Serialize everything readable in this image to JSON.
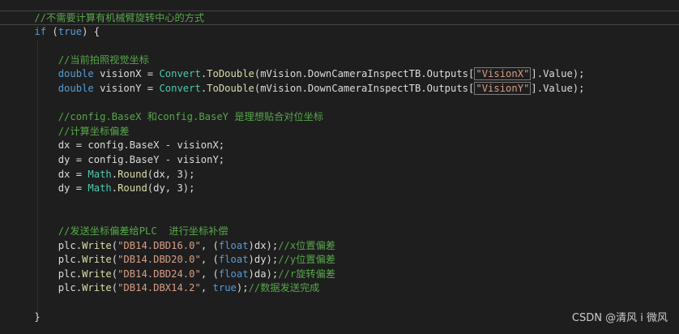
{
  "editor": {
    "theme_colors": {
      "background": "#1e1e1e",
      "comment": "#57a64a",
      "keyword": "#569cd6",
      "type": "#4ec9b0",
      "method": "#dcdcaa",
      "string": "#d69d85",
      "identifier": "#dcdcdc"
    },
    "lines": [
      {
        "tokens": [
          {
            "t": "    ",
            "c": "ident"
          },
          {
            "t": "//不需要计算有机械臂旋转中心的方式",
            "c": "comment"
          }
        ]
      },
      {
        "tokens": [
          {
            "t": "    ",
            "c": "ident"
          },
          {
            "t": "if",
            "c": "keyword"
          },
          {
            "t": " (",
            "c": "ident"
          },
          {
            "t": "true",
            "c": "keyword"
          },
          {
            "t": ") {",
            "c": "ident"
          }
        ]
      },
      {
        "tokens": []
      },
      {
        "tokens": [
          {
            "t": "        ",
            "c": "ident"
          },
          {
            "t": "//当前拍照视觉坐标",
            "c": "comment"
          }
        ]
      },
      {
        "tokens": [
          {
            "t": "        ",
            "c": "ident"
          },
          {
            "t": "double",
            "c": "keyword"
          },
          {
            "t": " visionX = ",
            "c": "ident"
          },
          {
            "t": "Convert",
            "c": "type"
          },
          {
            "t": ".",
            "c": "ident"
          },
          {
            "t": "ToDouble",
            "c": "method"
          },
          {
            "t": "(mVision.DownCameraInspectTB.Outputs[",
            "c": "ident"
          },
          {
            "t": "\"VisionX\"",
            "c": "string",
            "boxed": true
          },
          {
            "t": "].Value);",
            "c": "ident"
          }
        ]
      },
      {
        "tokens": [
          {
            "t": "        ",
            "c": "ident"
          },
          {
            "t": "double",
            "c": "keyword"
          },
          {
            "t": " visionY = ",
            "c": "ident"
          },
          {
            "t": "Convert",
            "c": "type"
          },
          {
            "t": ".",
            "c": "ident"
          },
          {
            "t": "ToDouble",
            "c": "method"
          },
          {
            "t": "(mVision.DownCameraInspectTB.Outputs[",
            "c": "ident"
          },
          {
            "t": "\"VisionY\"",
            "c": "string",
            "boxed": true
          },
          {
            "t": "].Value);",
            "c": "ident"
          }
        ]
      },
      {
        "tokens": []
      },
      {
        "tokens": [
          {
            "t": "        ",
            "c": "ident"
          },
          {
            "t": "//config.BaseX 和config.BaseY 是理想贴合对位坐标",
            "c": "comment"
          }
        ]
      },
      {
        "tokens": [
          {
            "t": "        ",
            "c": "ident"
          },
          {
            "t": "//计算坐标偏差",
            "c": "comment"
          }
        ]
      },
      {
        "tokens": [
          {
            "t": "        dx = config.BaseX - visionX;",
            "c": "ident"
          }
        ]
      },
      {
        "tokens": [
          {
            "t": "        dy = config.BaseY - visionY;",
            "c": "ident"
          }
        ]
      },
      {
        "tokens": [
          {
            "t": "        dx = ",
            "c": "ident"
          },
          {
            "t": "Math",
            "c": "type"
          },
          {
            "t": ".",
            "c": "ident"
          },
          {
            "t": "Round",
            "c": "method"
          },
          {
            "t": "(dx, 3);",
            "c": "ident"
          }
        ]
      },
      {
        "tokens": [
          {
            "t": "        dy = ",
            "c": "ident"
          },
          {
            "t": "Math",
            "c": "type"
          },
          {
            "t": ".",
            "c": "ident"
          },
          {
            "t": "Round",
            "c": "method"
          },
          {
            "t": "(dy, 3);",
            "c": "ident"
          }
        ]
      },
      {
        "tokens": []
      },
      {
        "tokens": []
      },
      {
        "tokens": [
          {
            "t": "        ",
            "c": "ident"
          },
          {
            "t": "//发送坐标偏差给PLC  进行坐标补偿",
            "c": "comment"
          }
        ]
      },
      {
        "tokens": [
          {
            "t": "        plc.",
            "c": "ident"
          },
          {
            "t": "Write",
            "c": "method"
          },
          {
            "t": "(",
            "c": "ident"
          },
          {
            "t": "\"DB14.DBD16.0\"",
            "c": "string"
          },
          {
            "t": ", (",
            "c": "ident"
          },
          {
            "t": "float",
            "c": "keyword"
          },
          {
            "t": ")dx);",
            "c": "ident"
          },
          {
            "t": "//x位置偏差",
            "c": "comment"
          }
        ]
      },
      {
        "tokens": [
          {
            "t": "        plc.",
            "c": "ident"
          },
          {
            "t": "Write",
            "c": "method"
          },
          {
            "t": "(",
            "c": "ident"
          },
          {
            "t": "\"DB14.DBD20.0\"",
            "c": "string"
          },
          {
            "t": ", (",
            "c": "ident"
          },
          {
            "t": "float",
            "c": "keyword"
          },
          {
            "t": ")dy);",
            "c": "ident"
          },
          {
            "t": "//y位置偏差",
            "c": "comment"
          }
        ]
      },
      {
        "tokens": [
          {
            "t": "        plc.",
            "c": "ident"
          },
          {
            "t": "Write",
            "c": "method"
          },
          {
            "t": "(",
            "c": "ident"
          },
          {
            "t": "\"DB14.DBD24.0\"",
            "c": "string"
          },
          {
            "t": ", (",
            "c": "ident"
          },
          {
            "t": "float",
            "c": "keyword"
          },
          {
            "t": ")da);",
            "c": "ident"
          },
          {
            "t": "//r旋转偏差",
            "c": "comment"
          }
        ]
      },
      {
        "tokens": [
          {
            "t": "        plc.",
            "c": "ident"
          },
          {
            "t": "Write",
            "c": "method"
          },
          {
            "t": "(",
            "c": "ident"
          },
          {
            "t": "\"DB14.DBX14.2\"",
            "c": "string"
          },
          {
            "t": ", ",
            "c": "ident"
          },
          {
            "t": "true",
            "c": "keyword"
          },
          {
            "t": ");",
            "c": "ident"
          },
          {
            "t": "//数据发送完成",
            "c": "comment"
          }
        ]
      },
      {
        "tokens": []
      },
      {
        "tokens": [
          {
            "t": "    }",
            "c": "ident"
          }
        ]
      }
    ]
  },
  "watermark": {
    "text": "CSDN @清风 i 微风"
  }
}
